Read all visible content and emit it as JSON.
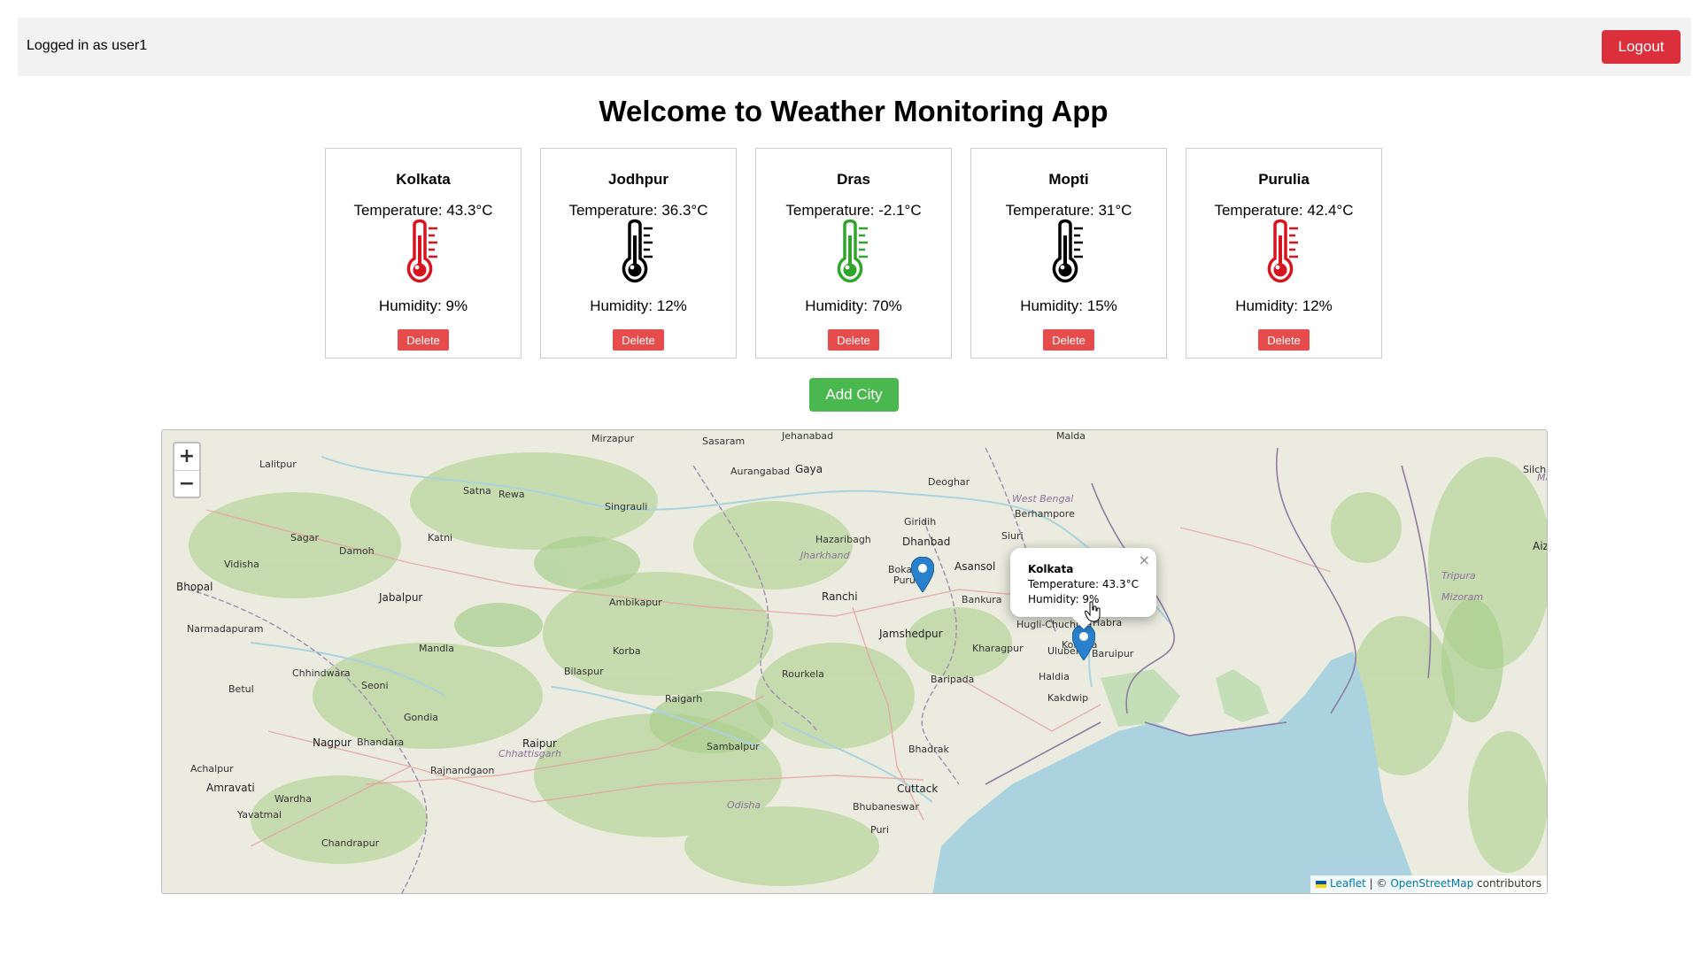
{
  "header": {
    "user_text": "Logged in as user1",
    "logout_label": "Logout"
  },
  "page_title": "Welcome to Weather Monitoring App",
  "cities": [
    {
      "name": "Kolkata",
      "temperature": "Temperature: 43.3°C",
      "humidity": "Humidity: 9%",
      "delete_label": "Delete",
      "thermometer_color": "#d8141e"
    },
    {
      "name": "Jodhpur",
      "temperature": "Temperature: 36.3°C",
      "humidity": "Humidity: 12%",
      "delete_label": "Delete",
      "thermometer_color": "#000000"
    },
    {
      "name": "Dras",
      "temperature": "Temperature: -2.1°C",
      "humidity": "Humidity: 70%",
      "delete_label": "Delete",
      "thermometer_color": "#2fa52b"
    },
    {
      "name": "Mopti",
      "temperature": "Temperature: 31°C",
      "humidity": "Humidity: 15%",
      "delete_label": "Delete",
      "thermometer_color": "#000000"
    },
    {
      "name": "Purulia",
      "temperature": "Temperature: 42.4°C",
      "humidity": "Humidity: 12%",
      "delete_label": "Delete",
      "thermometer_color": "#d8141e"
    }
  ],
  "add_city_label": "Add City",
  "map": {
    "zoom_in": "+",
    "zoom_out": "−",
    "popup": {
      "title": "Kolkata",
      "line1": "Temperature: 43.3°C",
      "line2": "Humidity: 9%",
      "close": "×"
    },
    "labels": [
      "Lalitpur",
      "Satna",
      "Rewa",
      "Mirzapur",
      "Sasaram",
      "Jehanabad",
      "Aurangabad",
      "Gaya",
      "Deoghar",
      "Malda",
      "Sagar",
      "Katni",
      "Singrauli",
      "Damoh",
      "Vidisha",
      "Bhopal",
      "Jabalpur",
      "Narmadapuram",
      "Mandla",
      "Chhindwara",
      "Seoni",
      "Betul",
      "Nagpur",
      "Bhandara",
      "Gondia",
      "Achalpur",
      "Amravati",
      "Wardha",
      "Yavatmal",
      "Chandrapur",
      "Rajnandgaon",
      "Raipur",
      "Ambikapur",
      "Korba",
      "Bilaspur",
      "Raigarh",
      "Sambalpur",
      "Rourkela",
      "Ranchi",
      "Hazaribagh",
      "Giridih",
      "Dhanbad",
      "Bokaro",
      "Purulia",
      "Asansol",
      "Bankura",
      "Jamshedpur",
      "Kharagpur",
      "Baripada",
      "Bhadrak",
      "Cuttack",
      "Bhubaneswar",
      "Puri",
      "Haldia",
      "Uluberia",
      "Baruipur",
      "Kakdwip",
      "Hugli-Chuchura",
      "Habra",
      "Kolkata",
      "Siuri",
      "Berhampore",
      "Jharkhand",
      "West Bengal",
      "Chhattisgarh",
      "Odisha",
      "Aizawl",
      "Mizoram",
      "Tripura",
      "Silchar",
      "Manipur"
    ],
    "attribution": {
      "leaflet": "Leaflet",
      "sep": " | © ",
      "osm": "OpenStreetMap",
      "suffix": " contributors"
    }
  }
}
